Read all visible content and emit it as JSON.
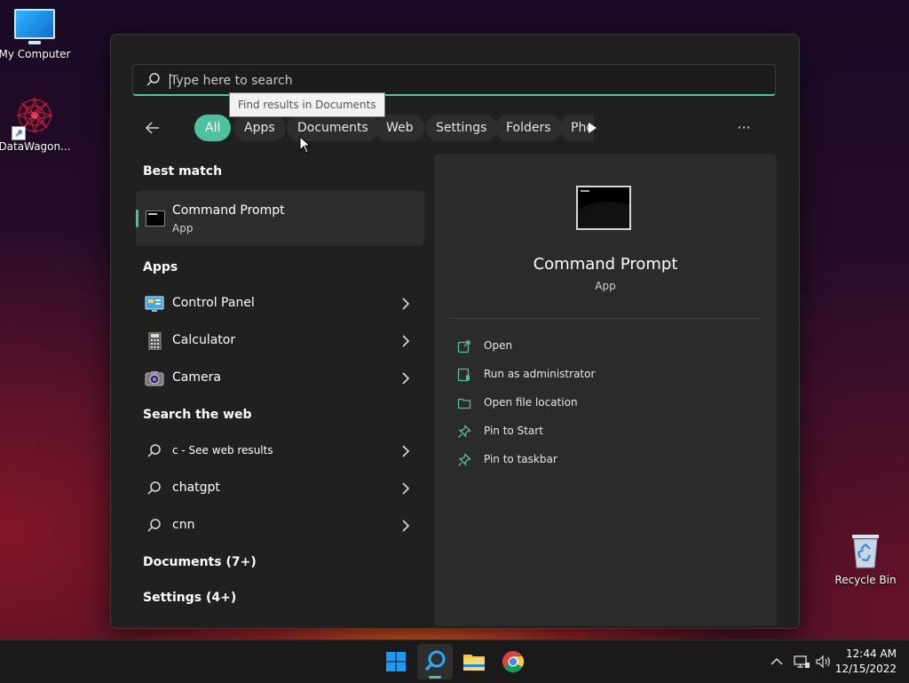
{
  "desktop": {
    "icons": [
      {
        "label": "My Computer"
      },
      {
        "label": "DataWagon..."
      },
      {
        "label": "Recycle Bin"
      }
    ]
  },
  "search": {
    "placeholder": "Type here to search",
    "tooltip": "Find results in Documents"
  },
  "filters": {
    "chips": [
      {
        "label": "All",
        "active": true
      },
      {
        "label": "Apps"
      },
      {
        "label": "Documents"
      },
      {
        "label": "Web"
      },
      {
        "label": "Settings"
      },
      {
        "label": "Folders"
      },
      {
        "label": "Pho"
      }
    ],
    "more": "···"
  },
  "results": {
    "best_match_title": "Best match",
    "best_match": {
      "name": "Command Prompt",
      "type": "App"
    },
    "apps_title": "Apps",
    "apps": [
      {
        "name": "Control Panel",
        "icon": "control-panel-icon"
      },
      {
        "name": "Calculator",
        "icon": "calculator-icon"
      },
      {
        "name": "Camera",
        "icon": "camera-icon"
      }
    ],
    "web_title": "Search the web",
    "web": [
      {
        "query": "c - See web results"
      },
      {
        "query": "chatgpt"
      },
      {
        "query": "cnn"
      }
    ],
    "documents_title": "Documents (7+)",
    "settings_title": "Settings (4+)"
  },
  "preview": {
    "name": "Command Prompt",
    "type": "App",
    "actions": [
      {
        "label": "Open",
        "icon": "open-icon"
      },
      {
        "label": "Run as administrator",
        "icon": "admin-icon"
      },
      {
        "label": "Open file location",
        "icon": "folder-icon"
      },
      {
        "label": "Pin to Start",
        "icon": "pin-icon"
      },
      {
        "label": "Pin to taskbar",
        "icon": "pin-icon"
      }
    ]
  },
  "taskbar": {
    "time": "12:44 AM",
    "date": "12/15/2022"
  },
  "colors": {
    "accent": "#4cc2a0",
    "panel": "#202020",
    "taskbar": "#1a1a1a"
  }
}
